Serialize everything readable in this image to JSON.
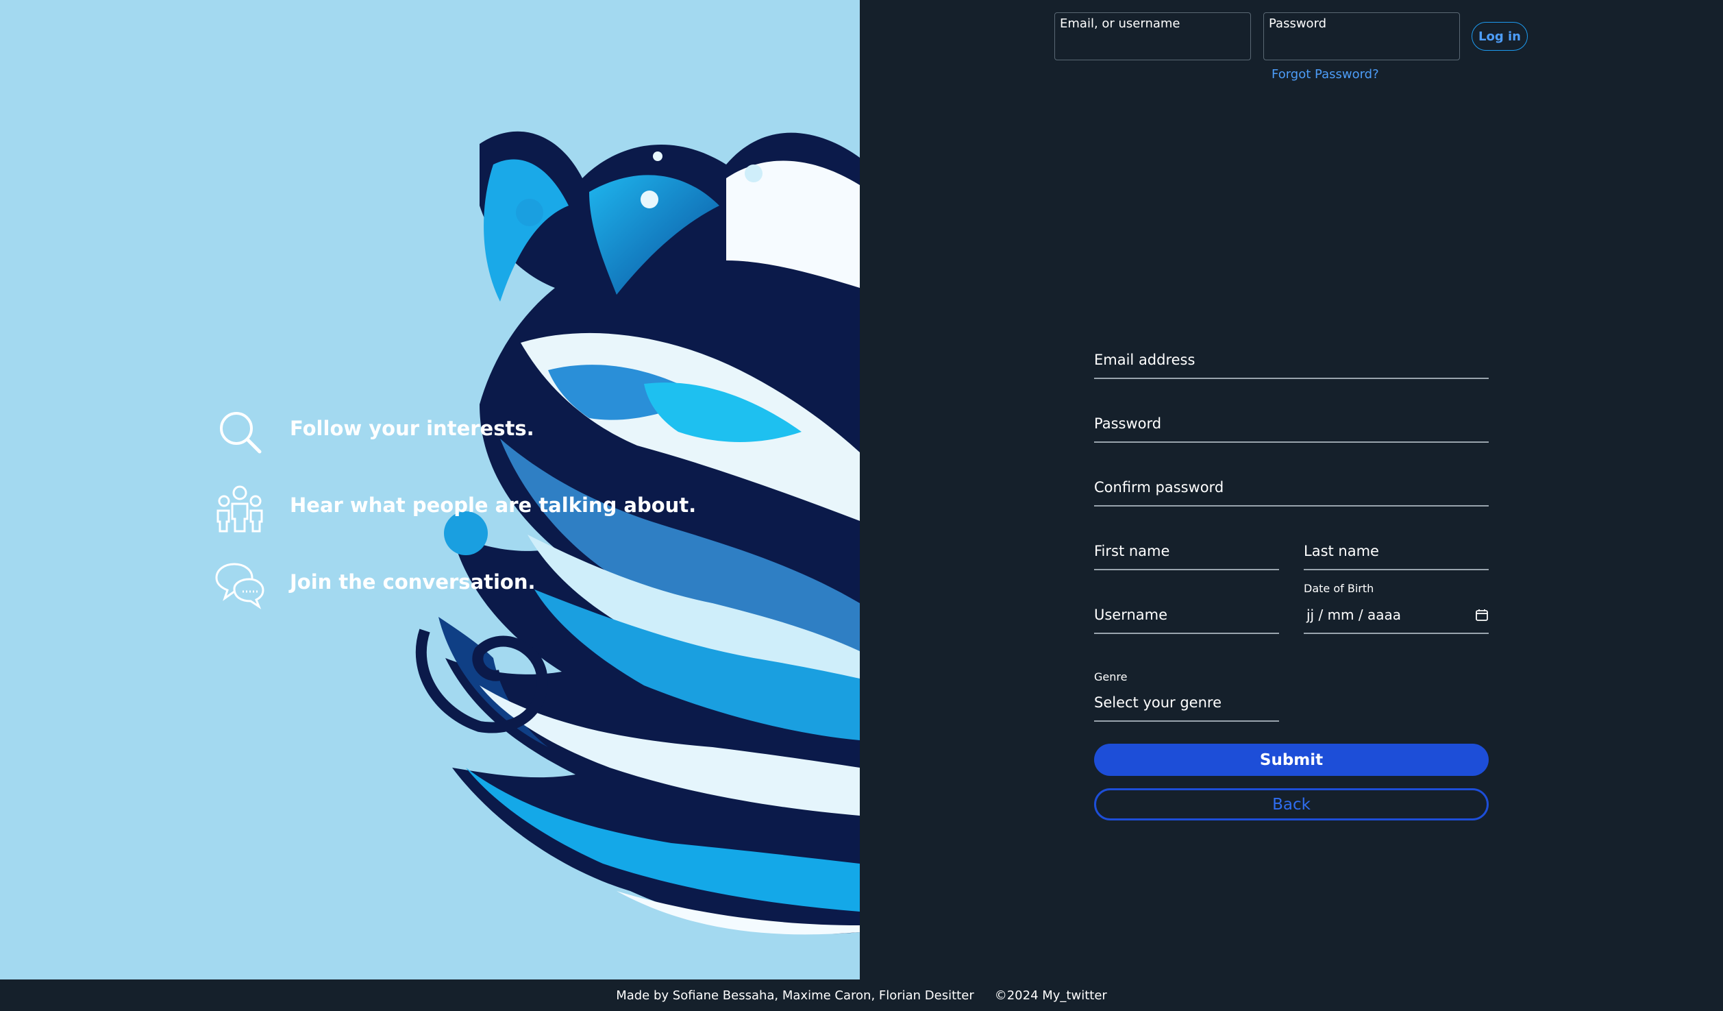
{
  "hero": {
    "features": [
      {
        "icon": "search-icon",
        "text": "Follow your interests."
      },
      {
        "icon": "people-icon",
        "text": "Hear what people are talking about."
      },
      {
        "icon": "chat-bubbles-icon",
        "text": "Join the conversation."
      }
    ]
  },
  "login": {
    "email_label": "Email, or username",
    "email_value": "",
    "password_label": "Password",
    "password_value": "",
    "button_label": "Log in",
    "forgot_label": "Forgot Password?"
  },
  "signup": {
    "email_label": "Email address",
    "password_label": "Password",
    "confirm_label": "Confirm password",
    "first_name_label": "First name",
    "last_name_label": "Last name",
    "username_label": "Username",
    "dob_label": "Date of Birth",
    "dob_value": "jj / mm / aaaa",
    "genre_label": "Genre",
    "genre_value": "Select your genre",
    "submit_label": "Submit",
    "back_label": "Back"
  },
  "footer": {
    "credits": "Made by Sofiane Bessaha, Maxime Caron, Florian Desitter",
    "copyright": "©2024 My_twitter"
  },
  "colors": {
    "panel_bg": "#15202b",
    "hero_bg": "#a3d9f0",
    "accent": "#1d4ed8",
    "link": "#4d9df8"
  }
}
